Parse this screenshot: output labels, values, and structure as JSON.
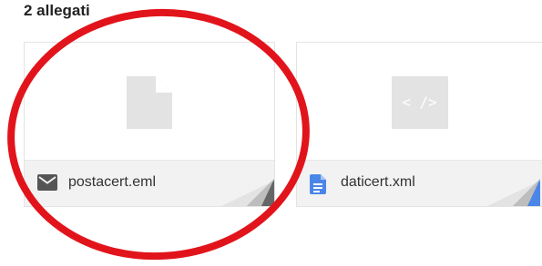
{
  "attachments_header": "2 allegati",
  "attachments": [
    {
      "filename": "postacert.eml",
      "type_icon": "mail-icon",
      "preview_icon": "generic-file-icon",
      "corner_color": "#666666"
    },
    {
      "filename": "daticert.xml",
      "type_icon": "document-icon",
      "preview_icon": "code-file-icon",
      "preview_glyph": "< />",
      "corner_color": "#4a86e8"
    }
  ],
  "colors": {
    "annotation_circle": "#e2141b",
    "preview_placeholder": "#e3e3e3",
    "footer_bg": "#f2f2f2"
  }
}
